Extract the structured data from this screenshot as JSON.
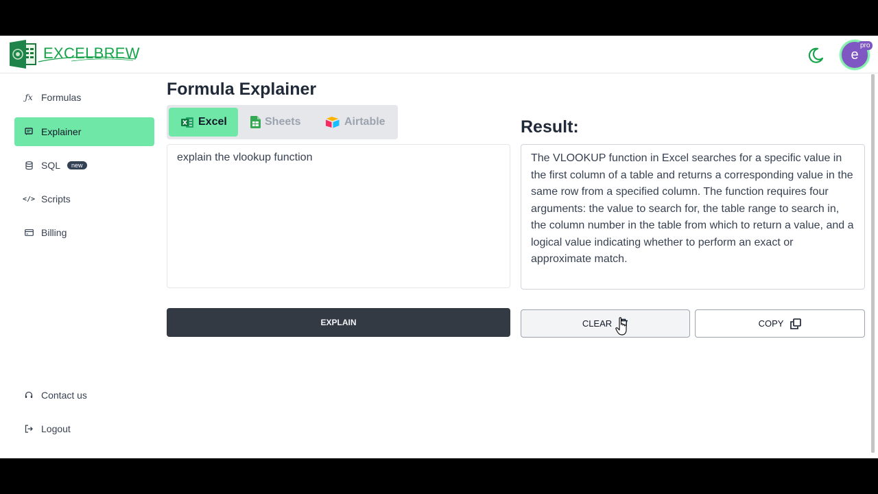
{
  "brand": {
    "name": "EXCELBREW"
  },
  "header": {
    "avatar_initial": "e",
    "avatar_badge": "pro",
    "theme_toggle_icon": "moon-icon"
  },
  "sidebar": {
    "items": [
      {
        "label": "Formulas",
        "icon": "function-icon"
      },
      {
        "label": "Explainer",
        "icon": "chat-icon",
        "active": true
      },
      {
        "label": "SQL",
        "icon": "database-icon",
        "badge": "new"
      },
      {
        "label": "Scripts",
        "icon": "code-icon"
      },
      {
        "label": "Billing",
        "icon": "credit-card-icon"
      }
    ],
    "bottom": [
      {
        "label": "Contact us",
        "icon": "headset-icon"
      },
      {
        "label": "Logout",
        "icon": "logout-icon"
      }
    ]
  },
  "main": {
    "title": "Formula Explainer",
    "tabs": [
      {
        "label": "Excel",
        "active": true
      },
      {
        "label": "Sheets"
      },
      {
        "label": "Airtable"
      }
    ],
    "input_value": "explain the vlookup function",
    "explain_label": "EXPLAIN",
    "result_title": "Result:",
    "result_text": "The VLOOKUP function in Excel searches for a specific value in the first column of a table and returns a corresponding value in the same row from a specified column. The function requires four arguments: the value to search for, the table range to search in, the column number in the table from which to return a value, and a logical value indicating whether to perform an exact or approximate match.",
    "clear_label": "CLEAR",
    "copy_label": "COPY"
  },
  "colors": {
    "brand_green": "#16a34a",
    "active_green": "#6ee7a7",
    "dark_button": "#343a44",
    "avatar_purple": "#7e57c2"
  }
}
